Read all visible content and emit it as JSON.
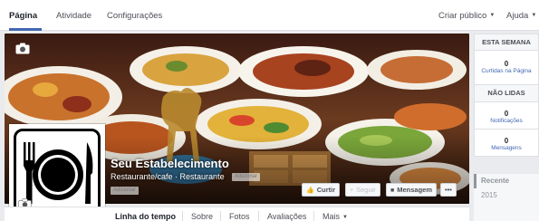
{
  "topnav": {
    "tabs": [
      {
        "label": "Página",
        "active": true
      },
      {
        "label": "Atividade",
        "active": false
      },
      {
        "label": "Configurações",
        "active": false
      }
    ],
    "create_public": "Criar público",
    "help": "Ajuda"
  },
  "cover": {
    "camera_icon": "camera-icon"
  },
  "profile": {
    "name": "Seu Estabelecimento",
    "category": "Restaurante/cafe · Restaurante",
    "chip_1": "Adicionar",
    "chip_2": "Adicionar"
  },
  "actions": {
    "like": "Curtir",
    "follow": "Seguir",
    "message": "Mensagem",
    "more": "•••"
  },
  "tabs": {
    "items": [
      "Linha do tempo",
      "Sobre",
      "Fotos",
      "Avaliações",
      "Mais"
    ]
  },
  "sidebar": {
    "week_header": "ESTA SEMANA",
    "likes_count": "0",
    "likes_label": "Curtidas na Página",
    "unread_header": "NÃO LIDAS",
    "notif_count": "0",
    "notif_label": "Notificações",
    "msg_count": "0",
    "msg_label": "Mensagens",
    "recent": "Recente",
    "year": "2015"
  },
  "colors": {
    "accent": "#4267b2",
    "background": "#e9ebee"
  }
}
